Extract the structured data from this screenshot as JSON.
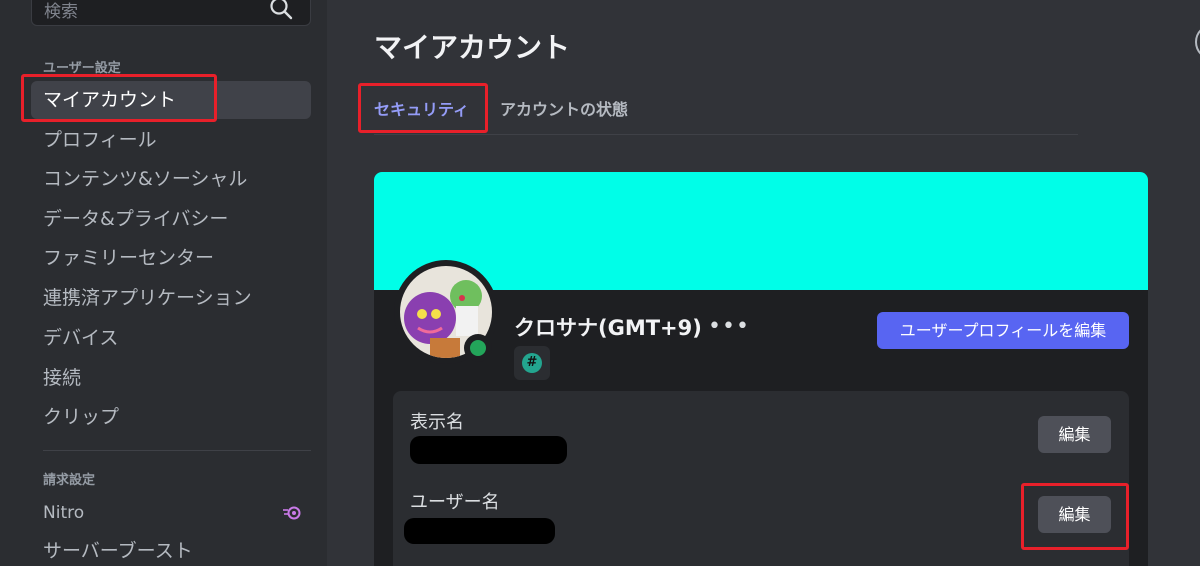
{
  "search": {
    "placeholder": "検索"
  },
  "sidebar": {
    "user_settings_header": "ユーザー設定",
    "items": [
      {
        "label": "マイアカウント"
      },
      {
        "label": "プロフィール"
      },
      {
        "label": "コンテンツ&ソーシャル"
      },
      {
        "label": "データ&プライバシー"
      },
      {
        "label": "ファミリーセンター"
      },
      {
        "label": "連携済アプリケーション"
      },
      {
        "label": "デバイス"
      },
      {
        "label": "接続"
      },
      {
        "label": "クリップ"
      }
    ],
    "billing_header": "請求設定",
    "billing_items": [
      {
        "label": "Nitro"
      },
      {
        "label": "サーバーブースト"
      }
    ]
  },
  "main": {
    "title": "マイアカウント",
    "tabs": [
      {
        "label": "セキュリティ"
      },
      {
        "label": "アカウントの状態"
      }
    ]
  },
  "profile": {
    "username": "クロサナ(GMT+9)",
    "more": "•••",
    "badge_symbol": "#",
    "edit_profile_label": "ユーザープロフィールを編集",
    "banner_color": "#00fee8"
  },
  "fields": {
    "display_name_label": "表示名",
    "username_label": "ユーザー名",
    "edit_label": "編集"
  },
  "colors": {
    "accent": "#5865f2",
    "online": "#23a55a",
    "highlight": "#e8202a"
  }
}
